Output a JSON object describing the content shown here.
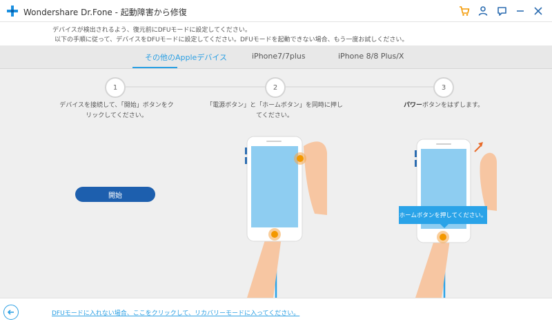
{
  "titlebar": {
    "title": "Wondershare Dr.Fone - 起動障害から修復",
    "icons": [
      "cart-icon",
      "user-icon",
      "feedback-icon",
      "minimize-icon",
      "close-icon"
    ],
    "accent_cart": "#f39800"
  },
  "info": {
    "line1": "デバイスが検出されるよう、復元前にDFUモードに設定してください。",
    "line2": "以下の手順に従って、デバイスをDFUモードに設定してください。DFUモードを起動できない場合、もう一度お試しください。"
  },
  "tabs": [
    {
      "label": "その他のAppleデバイス",
      "active": true
    },
    {
      "label": "iPhone7/7plus",
      "active": false
    },
    {
      "label": "iPhone 8/8 Plus/X",
      "active": false
    }
  ],
  "steps": [
    {
      "number": "1",
      "line1": "デバイスを接続して、「開始」ボタンをク",
      "line2": "リックしてください。"
    },
    {
      "number": "2",
      "line1": "「電源ボタン」と「ホームボタン」を同時に押し",
      "line2": "てください。"
    },
    {
      "number": "3",
      "bold": "パワー",
      "rest": "ボタンをはずします。"
    }
  ],
  "start_button": {
    "label": "開始"
  },
  "tooltip": {
    "text": "ホームボタンを押してください。"
  },
  "bottom": {
    "link": "DFUモードに入れない場合、ここをクリックして、リカバリーモードに入ってください。"
  },
  "colors": {
    "accent": "#2a9fe3",
    "button": "#1d5fae",
    "screen": "#8ecdf1",
    "finger": "#f7c6a2"
  }
}
